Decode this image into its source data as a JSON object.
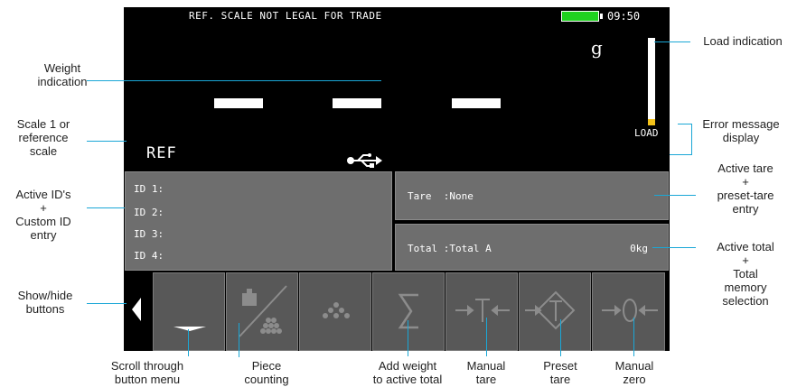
{
  "status_bar": {
    "message": "REF. SCALE NOT LEGAL FOR TRADE",
    "time": "09:50",
    "battery_level": 1.0,
    "battery_color": "#1fd11f"
  },
  "weight": {
    "unit": "g",
    "display": "— — —",
    "scale_label": "REF"
  },
  "load": {
    "label": "LOAD",
    "level": 0.07,
    "fill_color": "#f3c21a"
  },
  "usb_icon": "usb-icon",
  "ids": [
    {
      "label": "ID 1:",
      "value": ""
    },
    {
      "label": "ID 2:",
      "value": ""
    },
    {
      "label": "ID 3:",
      "value": ""
    },
    {
      "label": "ID 4:",
      "value": ""
    }
  ],
  "tare": {
    "label": "Tare",
    "value": ":None"
  },
  "total": {
    "label": "Total",
    "value": ":Total A",
    "amount": "0kg"
  },
  "buttons": [
    {
      "name": "show-hide-buttons",
      "icon": "triangle-left-icon"
    },
    {
      "name": "scroll-button-menu",
      "icon": "chevron-down-icon"
    },
    {
      "name": "piece-counting",
      "icon": "piece-counting-icon"
    },
    {
      "name": "pieces",
      "icon": "dots-icon"
    },
    {
      "name": "add-to-total",
      "icon": "sigma-icon"
    },
    {
      "name": "manual-tare",
      "icon": "tare-icon"
    },
    {
      "name": "preset-tare",
      "icon": "preset-tare-icon"
    },
    {
      "name": "manual-zero",
      "icon": "zero-icon"
    }
  ],
  "annotations": {
    "weight_indication": [
      "Weight",
      "indication"
    ],
    "load_indication": "Load indication",
    "scale_ref": [
      "Scale 1 or",
      "reference",
      "scale"
    ],
    "error_message": [
      "Error message",
      "display"
    ],
    "active_ids": [
      "Active ID's",
      "+",
      "Custom ID",
      "entry"
    ],
    "active_tare": [
      "Active tare",
      "+",
      "preset-tare",
      "entry"
    ],
    "active_total": [
      "Active total",
      "+",
      "Total",
      "memory",
      "selection"
    ],
    "show_hide": [
      "Show/hide",
      "buttons"
    ],
    "scroll": [
      "Scroll through",
      "button menu"
    ],
    "piece_counting": [
      "Piece",
      "counting"
    ],
    "add_weight": [
      "Add weight",
      "to active total"
    ],
    "manual_tare": [
      "Manual",
      "tare"
    ],
    "preset_tare": [
      "Preset",
      "tare"
    ],
    "manual_zero": [
      "Manual",
      "zero"
    ]
  }
}
